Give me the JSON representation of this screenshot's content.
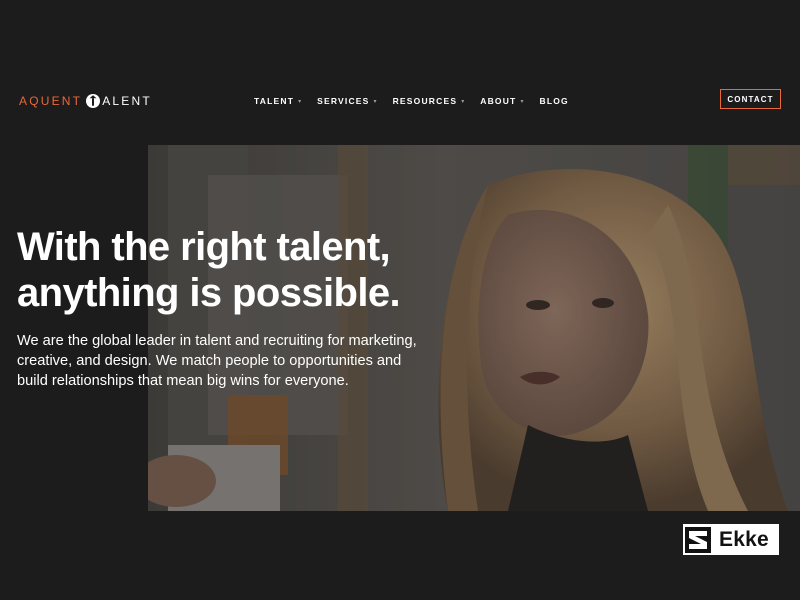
{
  "header": {
    "logo": {
      "word1": "AQUENT",
      "word2": "ALENT",
      "mark_icon": "aquent-t-icon",
      "accent_color": "#e8683a"
    },
    "nav": [
      {
        "label": "TALENT",
        "has_dropdown": true
      },
      {
        "label": "SERVICES",
        "has_dropdown": true
      },
      {
        "label": "RESOURCES",
        "has_dropdown": true
      },
      {
        "label": "ABOUT",
        "has_dropdown": true
      },
      {
        "label": "BLOG",
        "has_dropdown": false
      }
    ],
    "caret_glyph": "▾",
    "contact_label": "CONTACT"
  },
  "hero": {
    "headline_line1": "With the right talent,",
    "headline_line2": "anything is possible.",
    "subtext": "We are the global leader in talent and recruiting for marketing, creative, and design. We match people to opportunities and build relationships that mean big wins for everyone."
  },
  "badge": {
    "text": "Ekke",
    "icon": "ekke-logo-icon"
  },
  "colors": {
    "background": "#1c1c1c",
    "accent": "#e8683a",
    "text": "#ffffff"
  }
}
